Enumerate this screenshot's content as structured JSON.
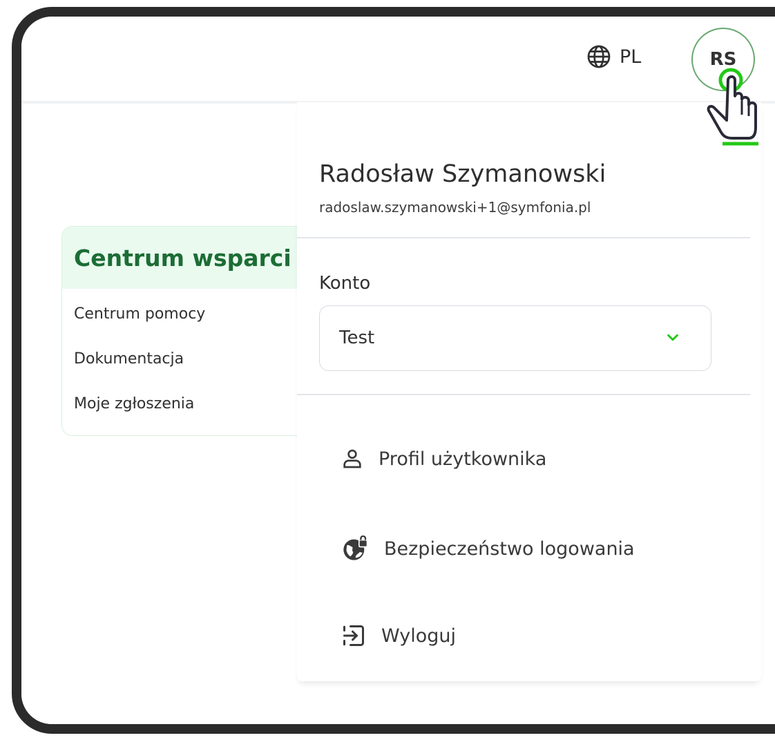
{
  "header": {
    "language_code": "PL",
    "avatar_initials": "RS"
  },
  "support": {
    "title": "Centrum wsparci",
    "links": [
      "Centrum pomocy",
      "Dokumentacja",
      "Moje zgłoszenia"
    ]
  },
  "account_menu": {
    "user_name": "Radosław Szymanowski",
    "user_email": "radoslaw.szymanowski+1@symfonia.pl",
    "account_label": "Konto",
    "account_selected": "Test",
    "items": [
      {
        "label": "Profil użytkownika",
        "icon": "user-icon"
      },
      {
        "label": "Bezpieczeństwo logowania",
        "icon": "secure-globe-icon"
      },
      {
        "label": "Wyloguj",
        "icon": "logout-icon"
      }
    ]
  },
  "colors": {
    "accent_green": "#1c6d35",
    "highlight_green": "#22c916",
    "card_header_bg": "#eafaef"
  }
}
